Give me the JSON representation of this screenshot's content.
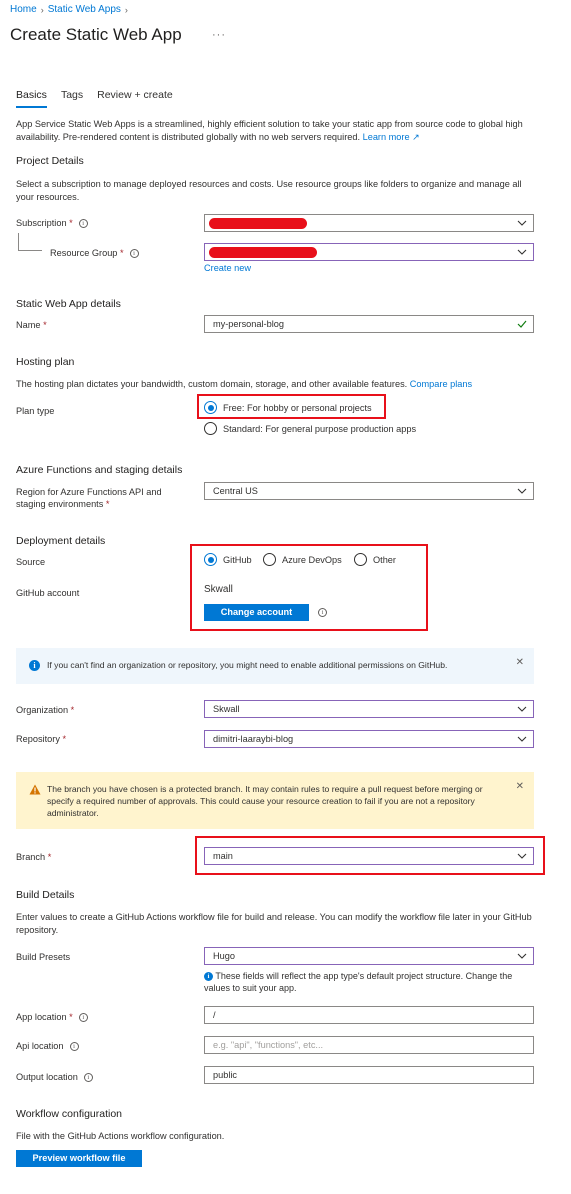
{
  "breadcrumb": {
    "home": "Home",
    "static_web_apps": "Static Web Apps"
  },
  "page": {
    "title": "Create Static Web App",
    "more": "···"
  },
  "tabs": [
    "Basics",
    "Tags",
    "Review + create"
  ],
  "intro": {
    "text": "App Service Static Web Apps is a streamlined, highly efficient solution to take your static app from source code to global high availability. Pre-rendered content is distributed globally with no web servers required.",
    "learn_more": "Learn more"
  },
  "project_details": {
    "heading": "Project Details",
    "description": "Select a subscription to manage deployed resources and costs. Use resource groups like folders to organize and manage all your resources.",
    "subscription_label": "Subscription",
    "resource_group_label": "Resource Group",
    "create_new": "Create new"
  },
  "app_details": {
    "heading": "Static Web App details",
    "name_label": "Name",
    "name_value": "my-personal-blog"
  },
  "hosting": {
    "heading": "Hosting plan",
    "description": "The hosting plan dictates your bandwidth, custom domain, storage, and other available features.",
    "compare_plans": "Compare plans",
    "plan_type_label": "Plan type",
    "free_option": "Free: For hobby or personal projects",
    "standard_option": "Standard: For general purpose production apps",
    "selected": "free"
  },
  "functions": {
    "heading": "Azure Functions and staging details",
    "region_label_1": "Region for Azure Functions API and",
    "region_label_2": "staging environments",
    "region_value": "Central US"
  },
  "deployment": {
    "heading": "Deployment details",
    "source_label": "Source",
    "sources": [
      "GitHub",
      "Azure DevOps",
      "Other"
    ],
    "selected_source": "GitHub",
    "github_account_label": "GitHub account",
    "github_account_value": "Skwall",
    "change_account": "Change account"
  },
  "info_banner": {
    "text": "If you can't find an organization or repository, you might need to enable additional permissions on GitHub."
  },
  "repo": {
    "organization_label": "Organization",
    "organization_value": "Skwall",
    "repository_label": "Repository",
    "repository_value": "dimitri-laaraybi-blog"
  },
  "warning_banner": {
    "text": "The branch you have chosen is a protected branch. It may contain rules to require a pull request before merging or specify a required number of approvals. This could cause your resource creation to fail if you are not a repository administrator."
  },
  "branch": {
    "label": "Branch",
    "value": "main"
  },
  "build": {
    "heading": "Build Details",
    "description": "Enter values to create a GitHub Actions workflow file for build and release. You can modify the workflow file later in your GitHub repository.",
    "presets_label": "Build Presets",
    "presets_value": "Hugo",
    "presets_note": "These fields will reflect the app type's default project structure. Change the values to suit your app.",
    "app_location_label": "App location",
    "app_location_value": "/",
    "api_location_label": "Api location",
    "api_location_placeholder": "e.g. \"api\", \"functions\", etc...",
    "output_location_label": "Output location",
    "output_location_value": "public"
  },
  "workflow": {
    "heading": "Workflow configuration",
    "description": "File with the GitHub Actions workflow configuration.",
    "preview_button": "Preview workflow file"
  },
  "colors": {
    "accent": "#0078d4",
    "highlight": "#e8101a",
    "required": "#a4262c",
    "warning_bg": "#fff4ce",
    "info_bg": "#eff6fc"
  }
}
